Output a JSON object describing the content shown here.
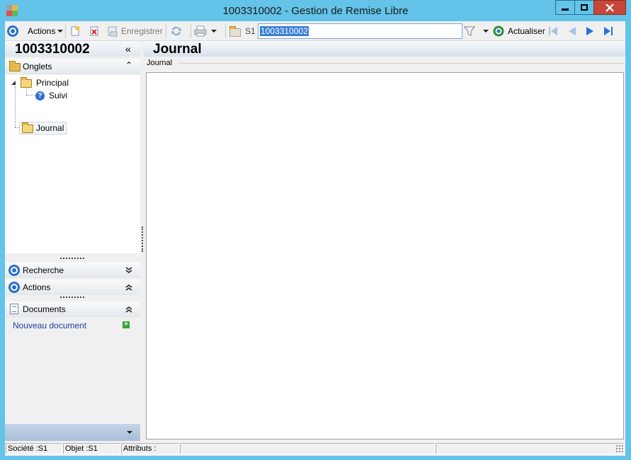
{
  "window": {
    "title": "1003310002 -  Gestion de Remise Libre",
    "app_icon": "app-grid-icon"
  },
  "toolbar": {
    "actions_label": "Actions",
    "save_label": "Enregistrer",
    "company_code": "S1",
    "record_value": "1003310002",
    "refresh_label": "Actualiser"
  },
  "left_panel": {
    "title": "1003310002",
    "sections": {
      "onglets": "Onglets",
      "recherche": "Recherche",
      "actions": "Actions",
      "documents": "Documents"
    },
    "tree": {
      "principal": "Principal",
      "suivi": "Suivi",
      "journal": "Journal"
    },
    "new_document_link": "Nouveau document"
  },
  "main": {
    "title": "Journal",
    "group_label": "Journal"
  },
  "statusbar": {
    "societe": "Société :S1",
    "objet": "Objet :S1",
    "attributs": "Attributs :"
  },
  "colors": {
    "window_chrome": "#63c3e8",
    "close_button": "#c7463c",
    "selection": "#3a7fd5",
    "link": "#1a3ea0"
  }
}
